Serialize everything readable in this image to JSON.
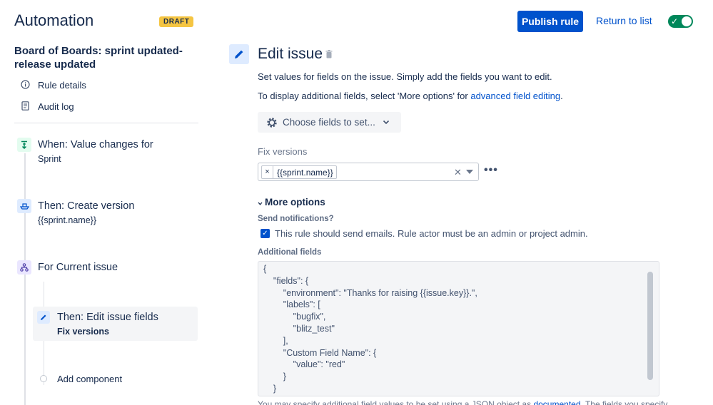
{
  "header": {
    "app_title": "Automation",
    "draft_badge": "DRAFT",
    "publish_label": "Publish rule",
    "return_label": "Return to list",
    "toggle_state": "on"
  },
  "sidebar": {
    "rule_name": "Board of Boards: sprint updated-release updated",
    "links": [
      {
        "label": "Rule details",
        "icon": "info-icon"
      },
      {
        "label": "Audit log",
        "icon": "document-icon"
      }
    ],
    "steps": [
      {
        "title": "When: Value changes for",
        "subtitle": "Sprint",
        "icon": "trigger-icon",
        "color": "#e3fcef"
      },
      {
        "title": "Then: Create version",
        "subtitle": "{{sprint.name}}",
        "icon": "ship-icon",
        "color": "#deebff"
      },
      {
        "title": "For Current issue",
        "subtitle": "",
        "icon": "branch-icon",
        "color": "#eae6ff"
      }
    ],
    "nested": {
      "title": "Then: Edit issue fields",
      "subtitle": "Fix versions",
      "icon": "pencil-icon"
    },
    "add_component": "Add component"
  },
  "main": {
    "title": "Edit issue",
    "desc1": "Set values for fields on the issue. Simply add the fields you want to edit.",
    "desc2_prefix": "To display additional fields, select 'More options' for ",
    "desc2_link": "advanced field editing",
    "desc2_suffix": ".",
    "choose_label": "Choose fields to set...",
    "fix_versions_label": "Fix versions",
    "fix_versions_tag": "{{sprint.name}}",
    "more_options": "More options",
    "send_notifications_label": "Send notifications?",
    "send_notifications_text": "This rule should send emails. Rule actor must be an admin or project admin.",
    "send_notifications_checked": true,
    "additional_fields_label": "Additional fields",
    "code": "{\n    \"fields\": {\n        \"environment\": \"Thanks for raising {{issue.key}}.\",\n        \"labels\": [\n            \"bugfix\",\n            \"blitz_test\"\n        ],\n        \"Custom Field Name\": {\n            \"value\": \"red\"\n        }\n    }",
    "footer_prefix": "You may specify additional field values to be set using a JSON object as ",
    "footer_link": "documented",
    "footer_suffix": ". The fields you specify"
  }
}
